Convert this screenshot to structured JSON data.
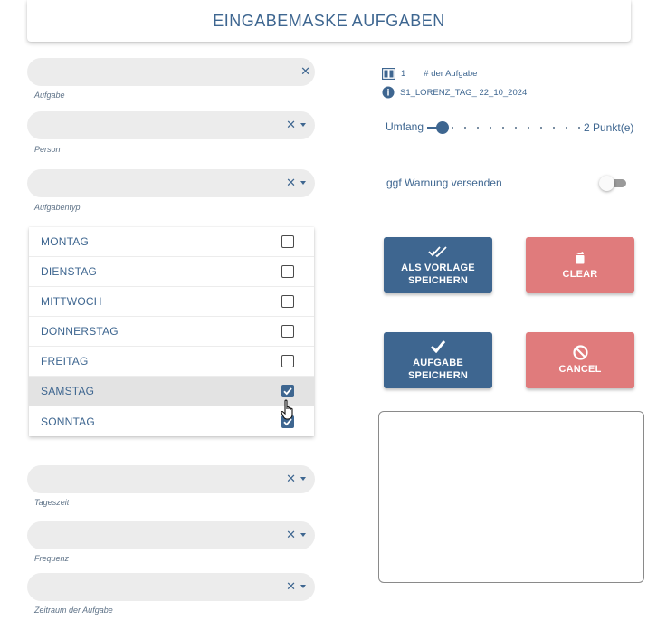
{
  "header": {
    "title": "EINGABEMASKE AUFGABEN"
  },
  "fields": {
    "aufgabe": {
      "label": "Aufgabe",
      "value": "",
      "clear_icon": "close-icon"
    },
    "person": {
      "label": "Person",
      "value": ""
    },
    "aufgabentyp": {
      "label": "Aufgabentyp",
      "value": ""
    },
    "tageszeit": {
      "label": "Tageszeit",
      "value": ""
    },
    "frequenz": {
      "label": "Frequenz",
      "value": ""
    },
    "zeitraum": {
      "label": "Zeitraum der Aufgabe",
      "value": ""
    }
  },
  "days": [
    {
      "label": "MONTAG",
      "checked": false
    },
    {
      "label": "DIENSTAG",
      "checked": false
    },
    {
      "label": "MITTWOCH",
      "checked": false
    },
    {
      "label": "DONNERSTAG",
      "checked": false
    },
    {
      "label": "FREITAG",
      "checked": false
    },
    {
      "label": "SAMSTAG",
      "checked": true,
      "highlighted": true
    },
    {
      "label": "SONNTAG",
      "checked": true
    }
  ],
  "info": {
    "task_number": "1",
    "task_number_label": "# der Aufgabe",
    "task_id": "S1_LORENZ_TAG_ 22_10_2024"
  },
  "umfang": {
    "label": "Umfang",
    "value_text": "2 Punkt(e)",
    "fraction": 0.1
  },
  "warning": {
    "label": "ggf Warnung versenden",
    "enabled": false
  },
  "buttons": {
    "save_template": "ALS VORLAGE SPEICHERN",
    "clear": "CLEAR",
    "save_task": "AUFGABE SPEICHERN",
    "cancel": "CANCEL"
  },
  "notes": {
    "value": ""
  },
  "colors": {
    "primary": "#3e6690",
    "danger": "#e07b7c",
    "field_bg": "#ececec"
  }
}
